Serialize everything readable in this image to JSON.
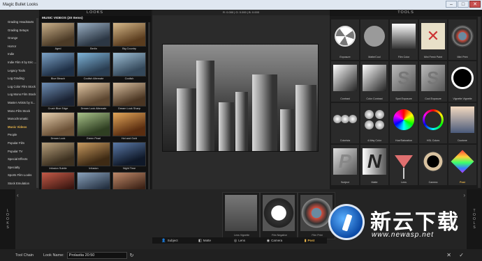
{
  "window": {
    "title": "Magic Bullet Looks"
  },
  "sidebar": {
    "items": [
      {
        "label": "Grading Headstarts",
        "active": false
      },
      {
        "label": "Grading Setups",
        "active": false
      },
      {
        "label": "Grunge",
        "active": false
      },
      {
        "label": "Horror",
        "active": false
      },
      {
        "label": "Indie",
        "active": false
      },
      {
        "label": "Indie Film II by Eric ...",
        "active": false
      },
      {
        "label": "Legacy Tools",
        "active": false
      },
      {
        "label": "Log Grading",
        "active": false
      },
      {
        "label": "Log Color Film Stock",
        "active": false
      },
      {
        "label": "Log Mono Film Stock",
        "active": false
      },
      {
        "label": "Master Artists by S...",
        "active": false
      },
      {
        "label": "Mono Film Stock",
        "active": false
      },
      {
        "label": "Monochromatic",
        "active": false
      },
      {
        "label": "Music Videos",
        "active": true
      },
      {
        "label": "People",
        "active": false
      },
      {
        "label": "Popular Film",
        "active": false
      },
      {
        "label": "Popular TV",
        "active": false
      },
      {
        "label": "Special Effects",
        "active": false
      },
      {
        "label": "Specialty",
        "active": false
      },
      {
        "label": "Sports Film Looks",
        "active": false
      },
      {
        "label": "Stock Emulation",
        "active": false
      },
      {
        "label": "Studio Insight V.Pl...",
        "active": false
      }
    ]
  },
  "looks": {
    "header": "LOOKS",
    "category_title": "MUSIC VIDEOS (20 Items)",
    "thumbs": [
      {
        "label": "Aged",
        "c1": "#c9b08a",
        "c2": "#4b3a26"
      },
      {
        "label": "Berlin",
        "c1": "#9bb0c4",
        "c2": "#2c3744"
      },
      {
        "label": "Big Country",
        "c1": "#d6b98a",
        "c2": "#5a3c1e"
      },
      {
        "label": "Blue Bleach",
        "c1": "#7da3c7",
        "c2": "#1e2f45"
      },
      {
        "label": "Coolish Alternate",
        "c1": "#7fb4d8",
        "c2": "#2a3e52"
      },
      {
        "label": "Coolish",
        "c1": "#9fc0d6",
        "c2": "#34485a"
      },
      {
        "label": "Crush Blue Edge",
        "c1": "#6f8fb5",
        "c2": "#1a2232"
      },
      {
        "label": "Dream Look Alternate",
        "c1": "#e2c8a6",
        "c2": "#5c4630"
      },
      {
        "label": "Dream Look Sharp",
        "c1": "#d8bfa0",
        "c2": "#4a3522"
      },
      {
        "label": "Dream Look",
        "c1": "#e6cfae",
        "c2": "#6a5036"
      },
      {
        "label": "Green Pearl",
        "c1": "#a9c28a",
        "c2": "#2f3f22"
      },
      {
        "label": "Hot and Gold",
        "c1": "#e3a75a",
        "c2": "#5a2d10"
      },
      {
        "label": "Infusion Subtle",
        "c1": "#b7a07c",
        "c2": "#3c3020"
      },
      {
        "label": "Infusion",
        "c1": "#c79a60",
        "c2": "#3e2a14"
      },
      {
        "label": "Night Time",
        "c1": "#5b7aa8",
        "c2": "#0f1828"
      },
      {
        "label": "",
        "c1": "#c45a48",
        "c2": "#3a1610"
      },
      {
        "label": "",
        "c1": "#8aa2bc",
        "c2": "#243040"
      },
      {
        "label": "",
        "c1": "#c08a6a",
        "c2": "#3c2216"
      }
    ]
  },
  "viewer": {
    "readout": "R: 0.000  |  G: 0.000  |  B: 0.000"
  },
  "tools": {
    "header": "TOOLS",
    "items": [
      {
        "label": "Exposure",
        "type": "aperture"
      },
      {
        "label": "Matte/Cool",
        "type": "disc-gray"
      },
      {
        "label": "Film Color",
        "type": "grad-v"
      },
      {
        "label": "Mini Fresh Paint",
        "type": "x-red"
      },
      {
        "label": "Mini Print",
        "type": "film-badge"
      },
      {
        "label": "Contrast",
        "type": "grad-diag"
      },
      {
        "label": "Color Contrast",
        "type": "grad-diag"
      },
      {
        "label": "Spot Exposure",
        "type": "letter-s"
      },
      {
        "label": "Cool Exposure",
        "type": "letter-s"
      },
      {
        "label": "Vignette Vignette",
        "type": "ring"
      },
      {
        "label": "Colorista",
        "type": "three-way"
      },
      {
        "label": "4-Way Color",
        "type": "four-way"
      },
      {
        "label": "Hue/Saturation",
        "type": "color-wheel"
      },
      {
        "label": "HSL Colors",
        "type": "color-ring"
      },
      {
        "label": "Duotone",
        "type": "duotone"
      },
      {
        "label": "Subject",
        "type": "letter-p"
      },
      {
        "label": "Matte",
        "type": "letter-n"
      },
      {
        "label": "Lens",
        "type": "glass"
      },
      {
        "label": "Camera",
        "type": "cam-ring"
      },
      {
        "label": "Post",
        "type": "cube"
      }
    ]
  },
  "chain": {
    "looks_vertical": "LOOKS",
    "tools_vertical": "TOOLS",
    "slots": [
      {
        "label": "Lens Vignette"
      },
      {
        "label": "Film Negative"
      },
      {
        "label": "Film Print"
      }
    ],
    "tabs": [
      {
        "label": "Subject",
        "active": false
      },
      {
        "label": "Matte",
        "active": false
      },
      {
        "label": "Lens",
        "active": false
      },
      {
        "label": "Camera",
        "active": false
      },
      {
        "label": "Post",
        "active": true
      }
    ]
  },
  "bottom": {
    "tool_chain_label": "Tool Chain",
    "look_name_label": "Look Name:",
    "look_name_value": "Prolastia 20:50"
  },
  "watermark": {
    "brand_cn": "新云下载",
    "url": "www.newasp.net"
  }
}
